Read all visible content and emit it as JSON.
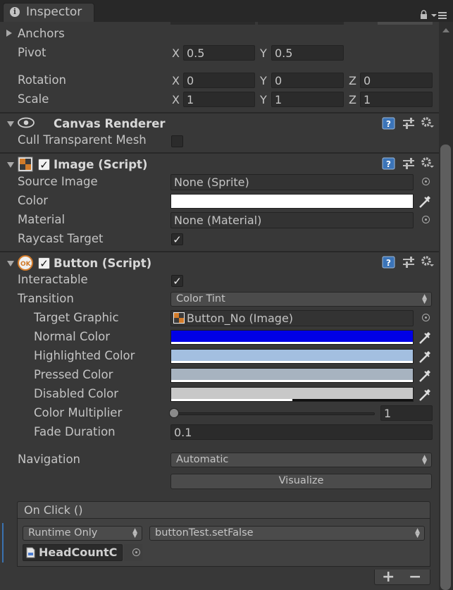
{
  "window": {
    "tab_title": "Inspector"
  },
  "transform": {
    "anchors_label": "Anchors",
    "pivot": {
      "label": "Pivot",
      "x_axis": "X",
      "x": "0.5",
      "y_axis": "Y",
      "y": "0.5"
    },
    "rotation": {
      "label": "Rotation",
      "x_axis": "X",
      "x": "0",
      "y_axis": "Y",
      "y": "0",
      "z_axis": "Z",
      "z": "0"
    },
    "scale": {
      "label": "Scale",
      "x_axis": "X",
      "x": "1",
      "y_axis": "Y",
      "y": "1",
      "z_axis": "Z",
      "z": "1"
    }
  },
  "canvas_renderer": {
    "title": "Canvas Renderer",
    "cull_label": "Cull Transparent Mesh",
    "cull_checked": false
  },
  "image": {
    "title": "Image (Script)",
    "enabled": true,
    "source_image_label": "Source Image",
    "source_image_value": "None (Sprite)",
    "color_label": "Color",
    "color_value": "#ffffff",
    "material_label": "Material",
    "material_value": "None (Material)",
    "raycast_label": "Raycast Target",
    "raycast_checked": true
  },
  "button": {
    "title": "Button (Script)",
    "enabled": true,
    "interactable_label": "Interactable",
    "interactable_checked": true,
    "transition_label": "Transition",
    "transition_value": "Color Tint",
    "target_graphic_label": "Target Graphic",
    "target_graphic_value": "Button_No (Image)",
    "normal_color_label": "Normal Color",
    "normal_color": "#0000e6",
    "highlighted_color_label": "Highlighted Color",
    "highlighted_color": "#a3bfe0",
    "pressed_color_label": "Pressed Color",
    "pressed_color": "#a7b3c0",
    "disabled_color_label": "Disabled Color",
    "disabled_color": "#c8c8c8",
    "disabled_alpha": 0.5,
    "color_multiplier_label": "Color Multiplier",
    "color_multiplier_value": "1",
    "color_multiplier_slider": 0.0,
    "fade_duration_label": "Fade Duration",
    "fade_duration_value": "0.1",
    "navigation_label": "Navigation",
    "navigation_value": "Automatic",
    "visualize_label": "Visualize"
  },
  "on_click": {
    "title": "On Click ()",
    "runtime_value": "Runtime Only",
    "function_value": "buttonTest.setFalse",
    "object_value": "HeadCountC",
    "add_label": "+",
    "remove_label": "−"
  },
  "icons": {
    "tab": "info-icon",
    "lock": "lock-icon",
    "menu": "context-menu-icon",
    "help": "help-book-icon",
    "preset": "preset-sliders-icon",
    "gear": "gear-icon",
    "eye": "eye-icon",
    "picker": "eyedropper-icon",
    "target": "object-picker-icon"
  }
}
